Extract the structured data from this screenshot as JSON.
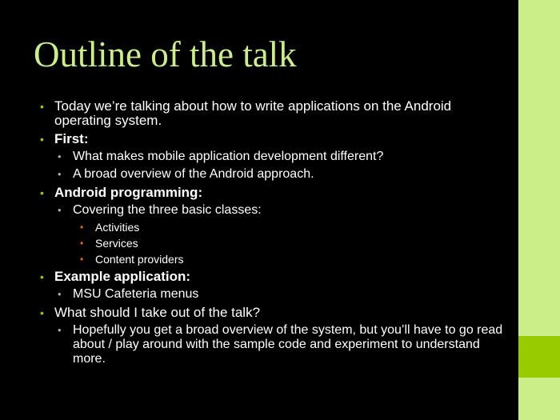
{
  "slide": {
    "title": "Outline of the talk",
    "bullets": [
      {
        "text": "Today we’re talking about how to write applications on the Android operating system."
      },
      {
        "text": "First:"
      },
      {
        "text": "What makes mobile application development different?"
      },
      {
        "text": "A broad overview of the Android approach."
      },
      {
        "text": "Android programming:"
      },
      {
        "text": "Covering the three basic classes:"
      },
      {
        "text": "Activities"
      },
      {
        "text": "Services"
      },
      {
        "text": "Content providers"
      },
      {
        "text": "Example application:"
      },
      {
        "text": "MSU Cafeteria menus"
      },
      {
        "text": "What should I take out of the talk?"
      },
      {
        "text": "Hopefully you get a broad overview of the system, but you’ll have to go read about / play around with the sample code and experiment to understand more."
      }
    ]
  },
  "colors": {
    "background": "#000000",
    "title": "#ccee88",
    "side_bar": "#ccee88",
    "side_block": "#99cc00",
    "level1_bullet": "#99cc00",
    "level2_bullet": "#aaaaaa",
    "level3_bullet": "#ff6600"
  }
}
